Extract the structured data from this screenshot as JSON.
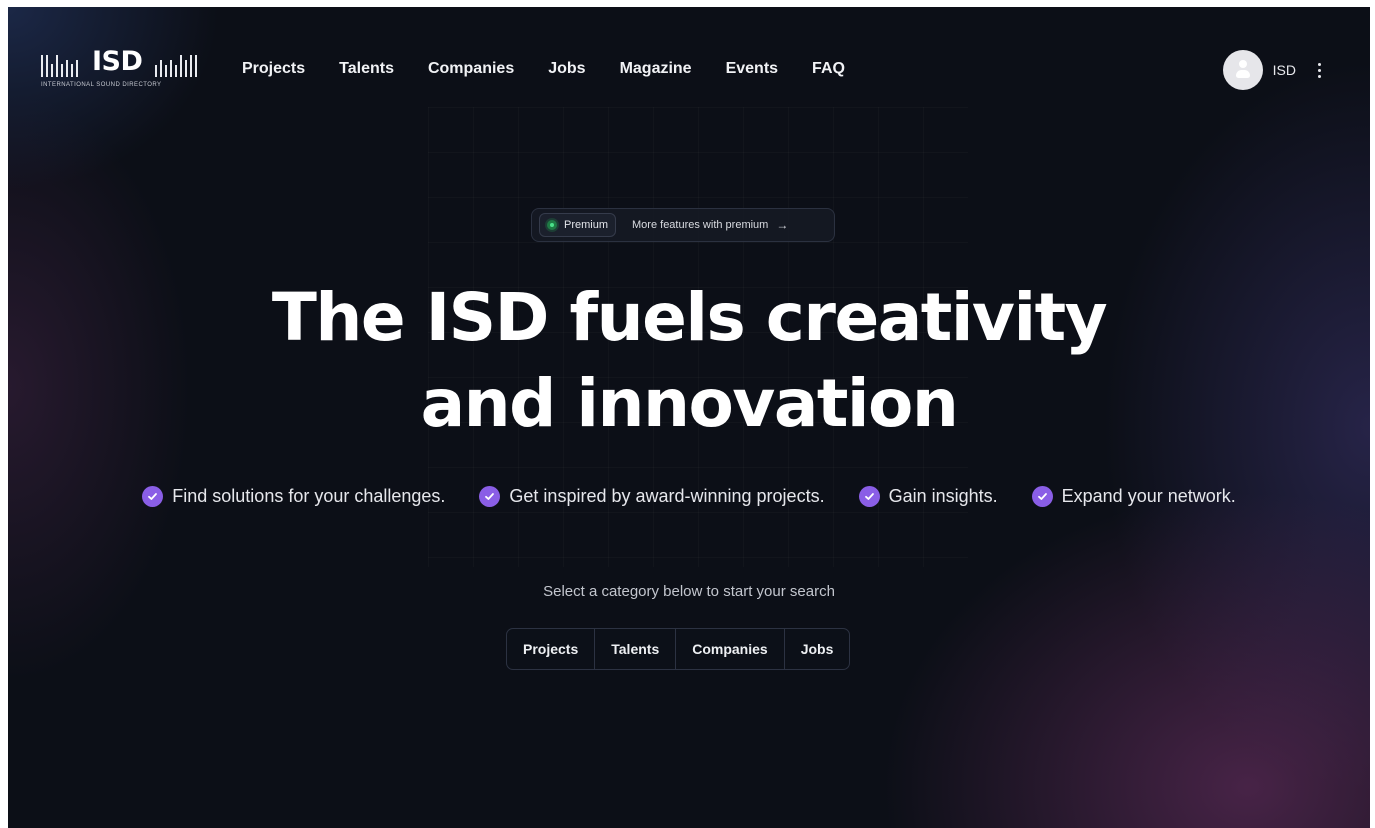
{
  "brand": {
    "name": "ISD",
    "tagline": "INTERNATIONAL SOUND DIRECTORY"
  },
  "nav": {
    "items": [
      {
        "label": "Projects"
      },
      {
        "label": "Talents"
      },
      {
        "label": "Companies"
      },
      {
        "label": "Jobs"
      },
      {
        "label": "Magazine"
      },
      {
        "label": "Events"
      },
      {
        "label": "FAQ"
      }
    ]
  },
  "user": {
    "name": "ISD",
    "avatar_icon": "user-avatar-icon",
    "menu_icon": "kebab-menu-icon"
  },
  "premium": {
    "tag": "Premium",
    "text": "More features with premium",
    "arrow": "→"
  },
  "hero": {
    "line1": "The ISD fuels creativity",
    "line2": "and innovation"
  },
  "benefits": [
    {
      "label": "Find solutions for your challenges."
    },
    {
      "label": "Get inspired by award-winning projects."
    },
    {
      "label": "Gain insights."
    },
    {
      "label": "Expand your network."
    }
  ],
  "search": {
    "hint": "Select a category below to start your search",
    "categories": [
      {
        "label": "Projects"
      },
      {
        "label": "Talents"
      },
      {
        "label": "Companies"
      },
      {
        "label": "Jobs"
      }
    ]
  },
  "colors": {
    "background": "#0c0f17",
    "accent": "#8a5ee6",
    "premium_dot": "#4be08a",
    "text": "#ffffff"
  }
}
